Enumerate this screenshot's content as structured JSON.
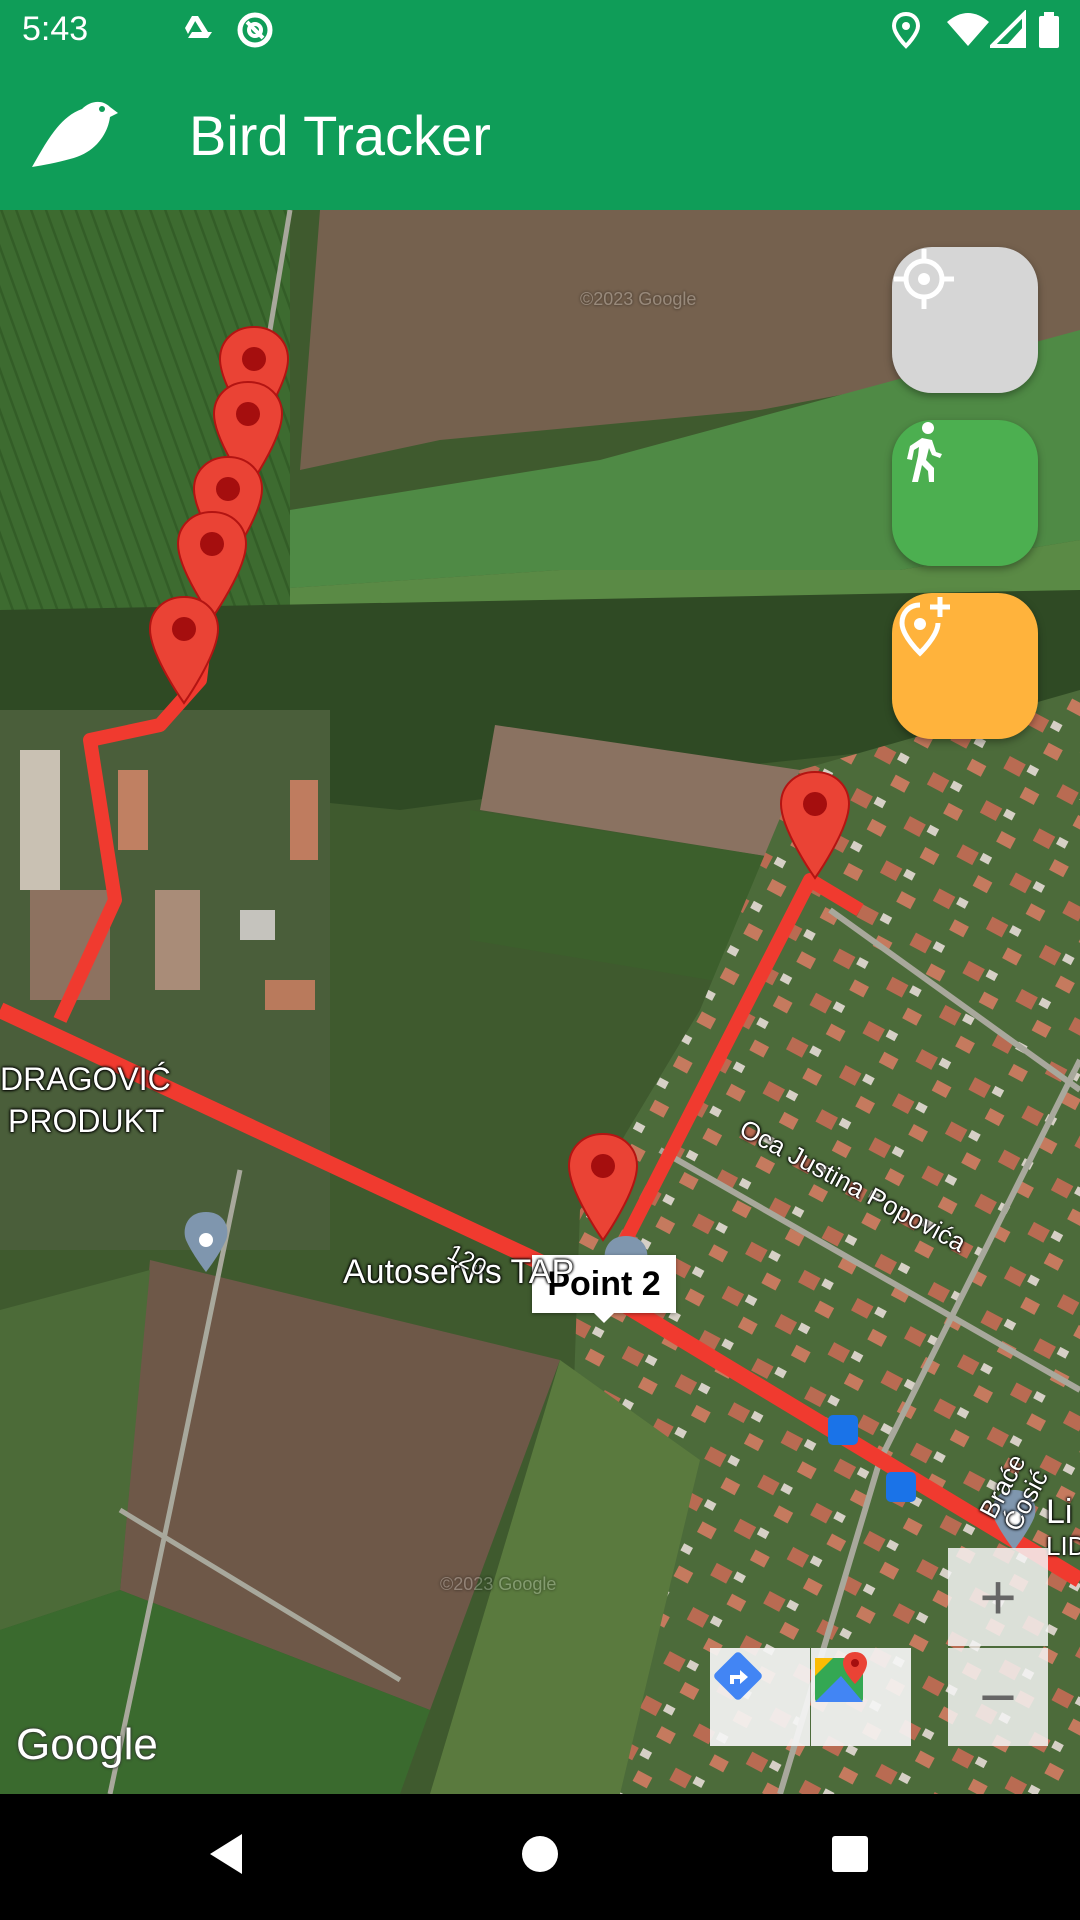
{
  "status_bar": {
    "time": "5:43",
    "left_icons": [
      "google-drive-icon",
      "sync-circle-icon"
    ],
    "right_icons": [
      "location-icon",
      "wifi-icon",
      "signal-icon",
      "battery-icon"
    ]
  },
  "app_bar": {
    "title": "Bird Tracker",
    "logo_icon": "bird-icon",
    "background": "#0f9d58"
  },
  "map": {
    "type": "satellite",
    "route_color": "#f03a2f",
    "markers": [
      {
        "name": "marker-1"
      },
      {
        "name": "marker-2"
      },
      {
        "name": "marker-3"
      },
      {
        "name": "marker-4"
      },
      {
        "name": "marker-5"
      },
      {
        "name": "marker-6"
      },
      {
        "name": "marker-point-2"
      }
    ],
    "info_window": {
      "text": "Point 2"
    },
    "labels": {
      "place_1": "DRAGOVIĆ",
      "place_1b": "PRODUKT",
      "place_2": "Autoservis TAP",
      "street_1": "Oca Justina Popovića",
      "street_2": "Braće Ćosić",
      "road_number": "120",
      "place_3": "Li",
      "place_3b": "LID"
    },
    "attribution": "Google",
    "watermark": "©2023 Google"
  },
  "fabs": [
    {
      "name": "my-location-button",
      "icon": "crosshair-icon",
      "color": "#d6d6d6"
    },
    {
      "name": "walk-mode-button",
      "icon": "walking-person-icon",
      "color": "#4caf50"
    },
    {
      "name": "add-location-button",
      "icon": "add-location-pin-icon",
      "color": "#ffb33c"
    }
  ],
  "map_toolbar": {
    "directions_icon": "directions-icon",
    "maps_icon": "google-maps-icon",
    "zoom_in": "+",
    "zoom_out": "−"
  },
  "nav_bar": {
    "icons": [
      "back-triangle-icon",
      "home-circle-icon",
      "recents-square-icon"
    ]
  }
}
